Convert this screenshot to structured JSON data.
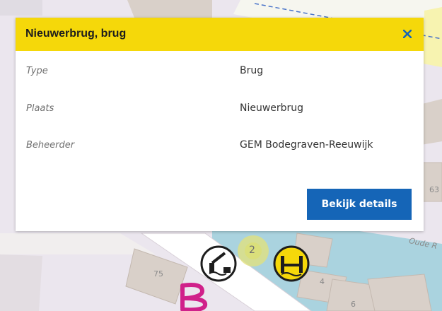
{
  "popup": {
    "title": "Nieuwerbrug, brug",
    "close_label": "×",
    "rows": [
      {
        "label": "Type",
        "value": "Brug"
      },
      {
        "label": "Plaats",
        "value": "Nieuwerbrug"
      },
      {
        "label": "Beheerder",
        "value": "GEM Bodegraven-Reeuwijk"
      }
    ],
    "details_button": "Bekijk details"
  },
  "map": {
    "labels": {
      "house_75": "75",
      "house_4": "4",
      "house_6": "6",
      "house_63": "63",
      "street": "Oude R",
      "cluster_count": "2"
    },
    "icons": [
      "bridge-closed-icon",
      "cluster-marker",
      "bridge-open-icon",
      "handwritten-mark"
    ]
  },
  "colors": {
    "header_yellow": "#f5d80a",
    "button_blue": "#1565b7",
    "water": "#aad3df",
    "buildings": "#d9d0c9",
    "residential": "#e9e4ee"
  }
}
